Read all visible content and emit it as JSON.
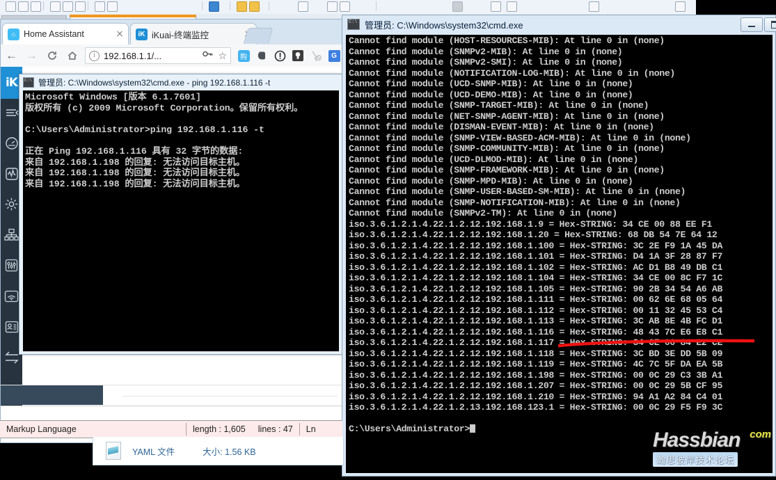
{
  "browser": {
    "tabs": [
      {
        "title": "Home Assistant",
        "favicon": "home-assistant-icon",
        "favicon_color": "#41bdf5",
        "active": true
      },
      {
        "title": "iKuai-终端监控",
        "favicon": "ikuai-icon",
        "favicon_color": "#1f8fd6",
        "active": false
      }
    ],
    "nav": {
      "back": "←",
      "forward": "→",
      "reload": "C",
      "home": "⌂"
    },
    "url": "192.168.1.1/...",
    "url_info_glyph": "i",
    "extensions": [
      "shopping-icon",
      "evernote-icon",
      "adblock-icon",
      "lightbulb-icon",
      "cursor-block-icon",
      "google-translate-icon"
    ],
    "bookmark_star": "☆",
    "key_icon": "key-icon"
  },
  "home_assistant": {
    "logo_text": "iK",
    "sidebar_icons": [
      "menu-collapse-icon",
      "gauge-icon",
      "activity-icon",
      "gear-icon",
      "network-icon",
      "sliders-icon",
      "wifi-icon",
      "contacts-icon",
      "arrows-icon"
    ]
  },
  "cmd_ping": {
    "title": "管理员: C:\\Windows\\system32\\cmd.exe - ping  192.168.1.116 -t",
    "icon": "cmd-icon",
    "lines": [
      "Microsoft Windows [版本 6.1.7601]",
      "版权所有 (c) 2009 Microsoft Corporation。保留所有权利。",
      "",
      "C:\\Users\\Administrator>ping 192.168.1.116 -t",
      "",
      "正在 Ping 192.168.1.116 具有 32 字节的数据:",
      "来自 192.168.1.198 的回复: 无法访问目标主机。",
      "来自 192.168.1.198 的回复: 无法访问目标主机。",
      "来自 192.168.1.198 的回复: 无法访问目标主机。"
    ]
  },
  "cmd_snmp": {
    "title": "管理员: C:\\Windows\\system32\\cmd.exe",
    "icon": "cmd-icon",
    "minimize_label": "minimize-button",
    "maximize_label": "maximize-button",
    "lines": [
      "Cannot find module (HOST-RESOURCES-MIB): At line 0 in (none)",
      "Cannot find module (SNMPv2-MIB): At line 0 in (none)",
      "Cannot find module (SNMPv2-SMI): At line 0 in (none)",
      "Cannot find module (NOTIFICATION-LOG-MIB): At line 0 in (none)",
      "Cannot find module (UCD-SNMP-MIB): At line 0 in (none)",
      "Cannot find module (UCD-DEMO-MIB): At line 0 in (none)",
      "Cannot find module (SNMP-TARGET-MIB): At line 0 in (none)",
      "Cannot find module (NET-SNMP-AGENT-MIB): At line 0 in (none)",
      "Cannot find module (DISMAN-EVENT-MIB): At line 0 in (none)",
      "Cannot find module (SNMP-VIEW-BASED-ACM-MIB): At line 0 in (none)",
      "Cannot find module (SNMP-COMMUNITY-MIB): At line 0 in (none)",
      "Cannot find module (UCD-DLMOD-MIB): At line 0 in (none)",
      "Cannot find module (SNMP-FRAMEWORK-MIB): At line 0 in (none)",
      "Cannot find module (SNMP-MPD-MIB): At line 0 in (none)",
      "Cannot find module (SNMP-USER-BASED-SM-MIB): At line 0 in (none)",
      "Cannot find module (SNMP-NOTIFICATION-MIB): At line 0 in (none)",
      "Cannot find module (SNMPv2-TM): At line 0 in (none)",
      "iso.3.6.1.2.1.4.22.1.2.12.192.168.1.9 = Hex-STRING: 34 CE 00 88 EE F1",
      "iso.3.6.1.2.1.4.22.1.2.12.192.168.1.20 = Hex-STRING: 68 DB 54 7E 64 12",
      "iso.3.6.1.2.1.4.22.1.2.12.192.168.1.100 = Hex-STRING: 3C 2E F9 1A 45 DA",
      "iso.3.6.1.2.1.4.22.1.2.12.192.168.1.101 = Hex-STRING: D4 1A 3F 28 87 F7",
      "iso.3.6.1.2.1.4.22.1.2.12.192.168.1.102 = Hex-STRING: AC D1 B8 49 DB C1",
      "iso.3.6.1.2.1.4.22.1.2.12.192.168.1.104 = Hex-STRING: 34 CE 00 8C F7 1C",
      "iso.3.6.1.2.1.4.22.1.2.12.192.168.1.105 = Hex-STRING: 90 2B 34 54 A6 AB",
      "iso.3.6.1.2.1.4.22.1.2.12.192.168.1.111 = Hex-STRING: 00 62 6E 68 05 64",
      "iso.3.6.1.2.1.4.22.1.2.12.192.168.1.112 = Hex-STRING: 00 11 32 45 53 C4",
      "iso.3.6.1.2.1.4.22.1.2.12.192.168.1.113 = Hex-STRING: 3C AB 8E 4B FC D1",
      "iso.3.6.1.2.1.4.22.1.2.12.192.168.1.116 = Hex-STRING: 48 43 7C E6 E8 C1",
      "iso.3.6.1.2.1.4.22.1.2.12.192.168.1.117 = Hex-STRING: 34 CE 00 84 E2 CE",
      "iso.3.6.1.2.1.4.22.1.2.12.192.168.1.118 = Hex-STRING: 3C BD 3E DD 5B 09",
      "iso.3.6.1.2.1.4.22.1.2.12.192.168.1.119 = Hex-STRING: 4C 7C 5F DA EA 5B",
      "iso.3.6.1.2.1.4.22.1.2.12.192.168.1.198 = Hex-STRING: 00 0C 29 C3 3B A1",
      "iso.3.6.1.2.1.4.22.1.2.12.192.168.1.207 = Hex-STRING: 00 0C 29 5B CF 95",
      "iso.3.6.1.2.1.4.22.1.2.12.192.168.1.210 = Hex-STRING: 94 A1 A2 84 C4 01",
      "iso.3.6.1.2.1.4.22.1.2.13.192.168.123.1 = Hex-STRING: 00 0C 29 F5 F9 3C",
      "",
      "C:\\Users\\Administrator>"
    ]
  },
  "annotation": {
    "name": "red-underline-stroke",
    "color": "#ee1111"
  },
  "watermark": {
    "brand": "Hassbian",
    "tld": "com",
    "chinese": "瀚思彼岸技术论坛"
  },
  "notepad_status": {
    "language": "Markup Language",
    "length": "length : 1,605",
    "lines": "lines : 47",
    "ln": "Ln"
  },
  "explorer": {
    "file_type": "YAML 文件",
    "size": "大小: 1.56 KB",
    "file_icon": "yaml-file-icon"
  }
}
